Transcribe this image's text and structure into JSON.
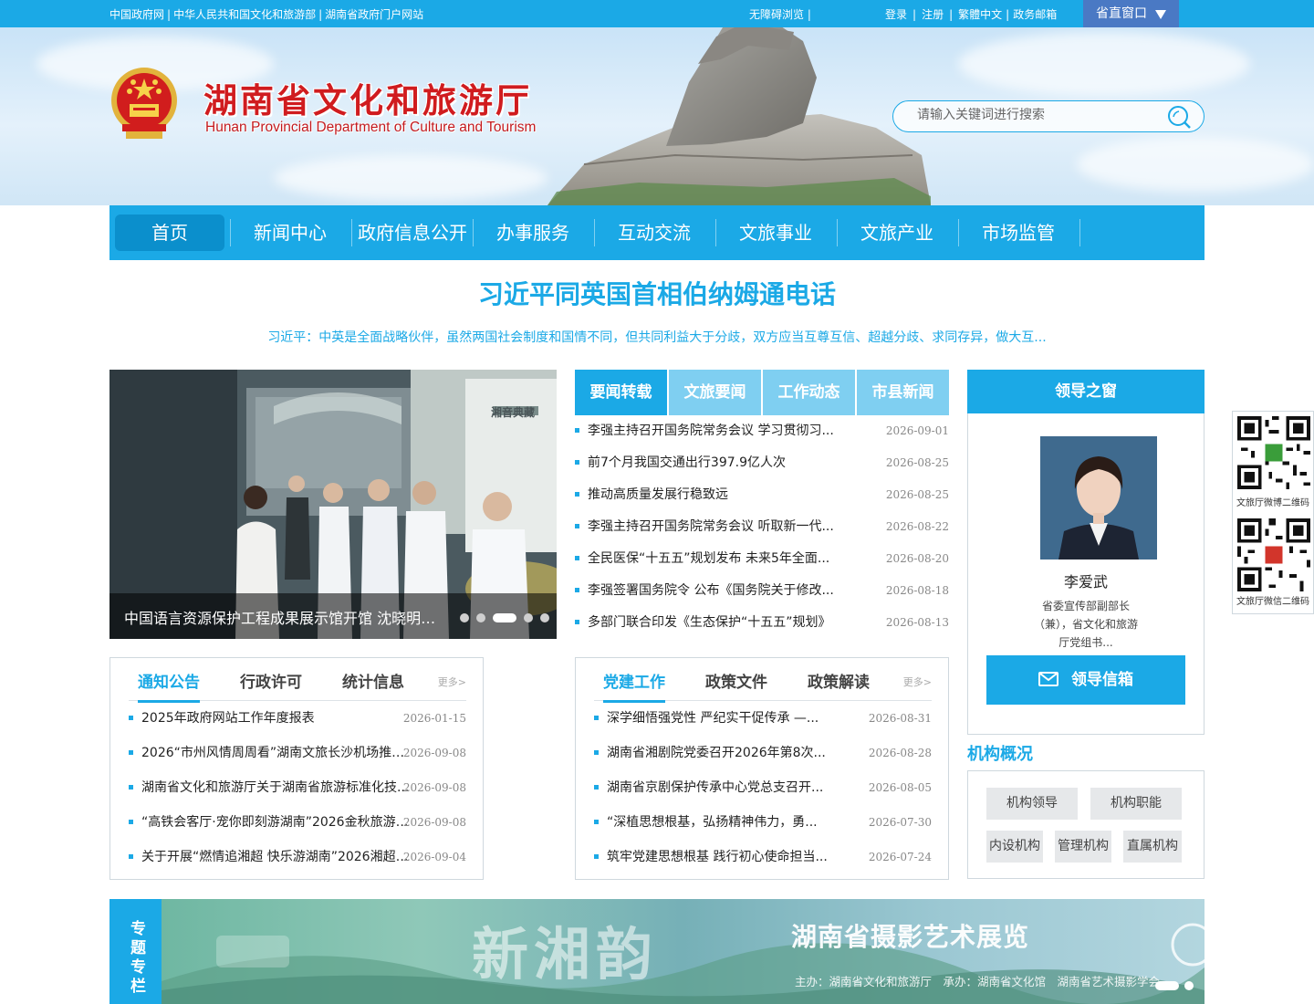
{
  "topbar": {
    "links": [
      "中国政府网",
      "中华人民共和国文化和旅游部",
      "湖南省政府门户网站"
    ],
    "accessibility": "无障碍浏览 |",
    "login": "登录",
    "register": "注册",
    "traditional": "繁體中文",
    "email": "政务邮箱",
    "window": "省直窗口"
  },
  "header": {
    "title": "湖南省文化和旅游厅",
    "subtitle": "Hunan Provincial Department of Culture and Tourism",
    "search_placeholder": "请输入关键词进行搜索"
  },
  "nav": [
    "首页",
    "新闻中心",
    "政府信息公开",
    "办事服务",
    "互动交流",
    "文旅事业",
    "文旅产业",
    "市场监管"
  ],
  "headline": {
    "title": "习近平同英国首相伯纳姆通电话",
    "summary": "习近平：中英是全面战略伙伴，虽然两国社会制度和国情不同，但共同利益大于分歧，双方应当互尊互信、超越分歧、求同存异，做大互..."
  },
  "carousel": {
    "caption": "中国语言资源保护工程成果展示馆开馆 沈晓明宣...",
    "slides": 5,
    "active": 3,
    "exhibit_sign": "湘音典藏"
  },
  "news_tabs": [
    "要闻转载",
    "文旅要闻",
    "工作动态",
    "市县新闻"
  ],
  "news": [
    {
      "title": "李强主持召开国务院常务会议 学习贯彻习...",
      "date": "2026-09-01"
    },
    {
      "title": "前7个月我国交通出行397.9亿人次",
      "date": "2026-08-25"
    },
    {
      "title": "推动高质量发展行稳致远",
      "date": "2026-08-25"
    },
    {
      "title": "李强主持召开国务院常务会议 听取新一代...",
      "date": "2026-08-22"
    },
    {
      "title": "全民医保“十五五”规划发布 未来5年全面...",
      "date": "2026-08-20"
    },
    {
      "title": "李强签署国务院令 公布《国务院关于修改...",
      "date": "2026-08-18"
    },
    {
      "title": "多部门联合印发《生态保护“十五五”规划》",
      "date": "2026-08-13"
    }
  ],
  "leader": {
    "heading": "领导之窗",
    "name": "李爱武",
    "duty": "省委宣传部副部长（兼），省文化和旅游厅党组书...",
    "mail_button": "领导信箱"
  },
  "org": {
    "title": "机构概况",
    "buttons": [
      "机构领导",
      "机构职能",
      "内设机构",
      "管理机构",
      "直属机构"
    ]
  },
  "notice": {
    "tabs": [
      "通知公告",
      "行政许可",
      "统计信息"
    ],
    "more": "更多>",
    "items": [
      {
        "title": "2025年政府网站工作年度报表",
        "date": "2026-01-15"
      },
      {
        "title": "2026“市州风情周周看”湖南文旅长沙机场推广...",
        "date": "2026-09-08"
      },
      {
        "title": "湖南省文化和旅游厅关于湖南省旅游标准化技...",
        "date": "2026-09-08"
      },
      {
        "title": "“高铁会客厅·宠你即刻游湖南”2026金秋旅游推...",
        "date": "2026-09-08"
      },
      {
        "title": "关于开展“燃情追湘超 快乐游湖南”2026湘超文...",
        "date": "2026-09-04"
      }
    ]
  },
  "party": {
    "tabs": [
      "党建工作",
      "政策文件",
      "政策解读"
    ],
    "more": "更多>",
    "items": [
      {
        "title": "深学细悟强党性 严纪实干促传承 —...",
        "date": "2026-08-31"
      },
      {
        "title": "湖南省湘剧院党委召开2026年第8次...",
        "date": "2026-08-28"
      },
      {
        "title": "湖南省京剧保护传承中心党总支召开...",
        "date": "2026-08-05"
      },
      {
        "title": "“深植思想根基，弘扬精神伟力，勇...",
        "date": "2026-07-30"
      },
      {
        "title": "筑牢党建思想根基 践行初心使命担当...",
        "date": "2026-07-24"
      }
    ]
  },
  "special": {
    "label": "专题专栏",
    "banner_title": "湖南省摄影艺术展览",
    "banner_calligraphy": "新湘韵",
    "banner_sub": "主办：湖南省文化和旅游厅　承办：湖南省文化馆　湖南省艺术摄影学会",
    "slides": 2,
    "active": 1
  },
  "qr": {
    "weibo": "文旅厅微博二维码",
    "wechat": "文旅厅微信二维码"
  },
  "colors": {
    "primary": "#1ba9e6",
    "nav_active": "#0b8fcc",
    "title_red": "#d01c1f",
    "window_btn": "#4a79c4"
  }
}
